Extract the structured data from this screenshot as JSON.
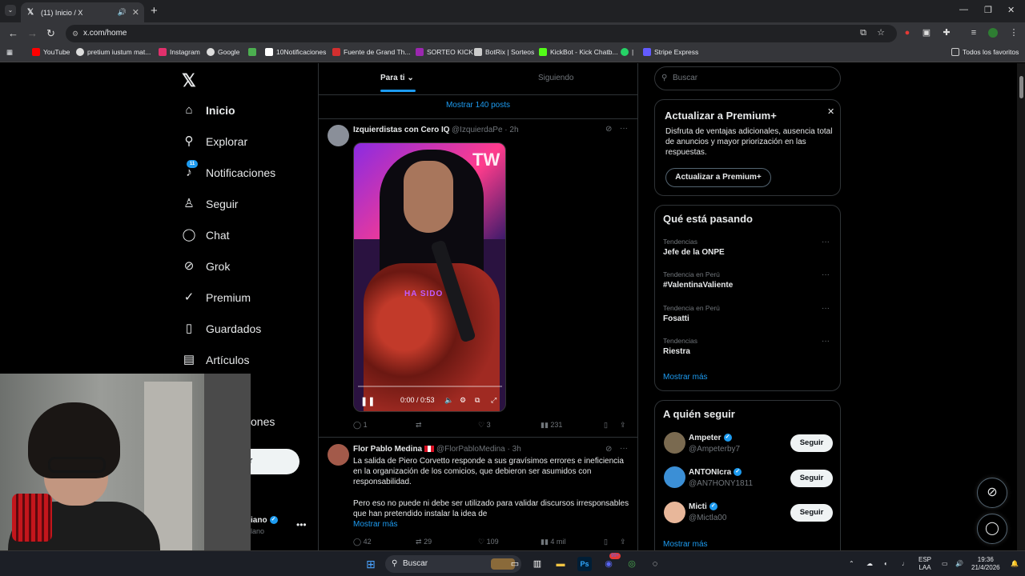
{
  "browser": {
    "tab_title": "(11) Inicio / X",
    "url": "x.com/home",
    "bookmarks": [
      {
        "label": "YouTube",
        "color": "#ff0000"
      },
      {
        "label": "pretium iustum mat...",
        "color": "#dddddd"
      },
      {
        "label": "Instagram",
        "color": "#e1306c"
      },
      {
        "label": "Google",
        "color": "#dddddd"
      },
      {
        "label": "",
        "color": "#4caf50"
      },
      {
        "label": "10Notificaciones",
        "color": "#ffffff"
      },
      {
        "label": "Fuente de Grand Th...",
        "color": "#d32f2f"
      },
      {
        "label": "SORTEO KICK",
        "color": "#9c27b0"
      },
      {
        "label": "BotRix | Sorteos",
        "color": "#cccccc"
      },
      {
        "label": "KickBot - Kick Chatb...",
        "color": "#53fc18"
      },
      {
        "label": "",
        "color": "#25d366"
      },
      {
        "label": "|",
        "color": "transparent"
      },
      {
        "label": "Stripe Express",
        "color": "#635bff"
      }
    ],
    "all_bookmarks": "Todos los favoritos"
  },
  "nav": {
    "items": [
      {
        "label": "Inicio",
        "icon": "home-icon"
      },
      {
        "label": "Explorar",
        "icon": "search-icon"
      },
      {
        "label": "Notificaciones",
        "icon": "bell-icon"
      },
      {
        "label": "Seguir",
        "icon": "add-person-icon"
      },
      {
        "label": "Chat",
        "icon": "chat-icon"
      },
      {
        "label": "Grok",
        "icon": "grok-icon"
      },
      {
        "label": "Premium",
        "icon": "premium-icon"
      },
      {
        "label": "Guardados",
        "icon": "bookmark-icon"
      },
      {
        "label": "Artículos",
        "icon": "articles-icon"
      }
    ],
    "notif_badge": "11",
    "hidden_item_label": "ones",
    "post_button_partial": "r",
    "account_name": "iano",
    "account_handle": "lano"
  },
  "feed": {
    "tab_for_you": "Para ti",
    "tab_following": "Siguiendo",
    "show_posts": "Mostrar 140 posts",
    "tweets": [
      {
        "name": "Izquierdistas con Cero IQ",
        "handle": "@IzquierdaPe · 2h",
        "video_overlay": "HA SIDO",
        "video_brand": "TW",
        "video_time": "0:00 / 0:53",
        "video_progress": 0.0,
        "replies": "1",
        "reposts": "",
        "likes": "3",
        "views": "231"
      },
      {
        "name": "Flor Pablo Medina",
        "handle": "@FlorPabloMedina · 3h",
        "text_1": "La salida de Piero Corvetto responde a sus gravísimos errores e ineficiencia en la organización de los comicios, que debieron ser asumidos con responsabilidad.",
        "text_2": "Pero eso no puede ni debe ser utilizado para validar discursos irresponsables que han pretendido instalar la idea de",
        "more": "Mostrar más",
        "replies": "42",
        "reposts": "29",
        "likes": "109",
        "views": "4 mil"
      }
    ]
  },
  "sidebar": {
    "search_placeholder": "Buscar",
    "premium": {
      "title": "Actualizar a Premium+",
      "body": "Disfruta de ventajas adicionales, ausencia total de anuncios y mayor priorización en las respuestas.",
      "button": "Actualizar a Premium+"
    },
    "trends_title": "Qué está pasando",
    "trends": [
      {
        "label": "Tendencias",
        "name": "Jefe de la ONPE"
      },
      {
        "label": "Tendencia en Perú",
        "name": "#ValentinaValiente"
      },
      {
        "label": "Tendencia en Perú",
        "name": "Fosatti"
      },
      {
        "label": "Tendencias",
        "name": "Riestra"
      }
    ],
    "trends_more": "Mostrar más",
    "follow_title": "A quién seguir",
    "follow": [
      {
        "name": "Ampeter",
        "handle": "@Ampeterby7",
        "button": "Seguir"
      },
      {
        "name": "ANTONIcra",
        "handle": "@AN7HONY1811",
        "button": "Seguir"
      },
      {
        "name": "Micti",
        "handle": "@Mictla00",
        "button": "Seguir"
      }
    ],
    "follow_more": "Mostrar más"
  },
  "taskbar": {
    "search_label": "Buscar",
    "lang_1": "ESP",
    "lang_2": "LAA",
    "time": "19:36",
    "date": "21/4/2026",
    "discord_badge": "99+"
  },
  "colors": {
    "accent": "#1d9bf0",
    "background": "#000000",
    "border": "#2f3336"
  }
}
